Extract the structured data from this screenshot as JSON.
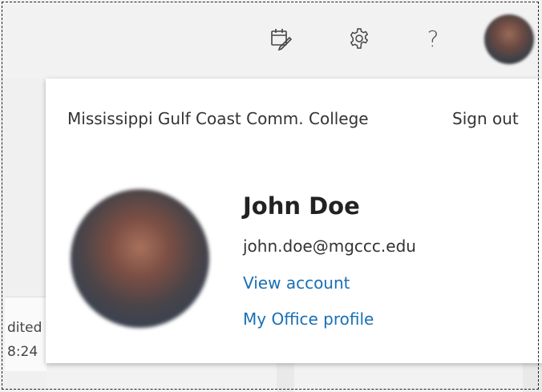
{
  "topbar": {
    "icons": [
      "my-day-icon",
      "settings-icon",
      "help-icon"
    ],
    "help_glyph": "?"
  },
  "background": {
    "card_line1": "dited",
    "card_line2": "8:24"
  },
  "account_panel": {
    "organization": "Mississippi Gulf Coast Comm. College",
    "sign_out": "Sign out",
    "user_name": "John Doe",
    "email": "john.doe@mgccc.edu",
    "view_account": "View account",
    "office_profile": "My Office profile"
  },
  "colors": {
    "link": "#1a6fb4",
    "panel_bg": "#ffffff",
    "page_bg": "#f2f2f2"
  }
}
